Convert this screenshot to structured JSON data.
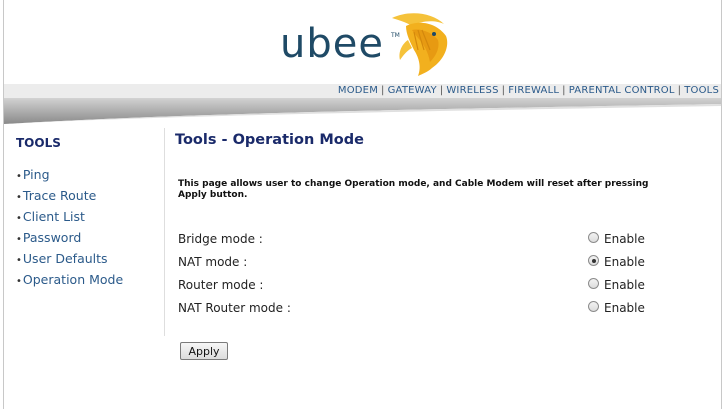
{
  "brand": {
    "logo_text": "ubee",
    "trademark": "TM"
  },
  "topnav": {
    "items": [
      "MODEM",
      "GATEWAY",
      "WIRELESS",
      "FIREWALL",
      "PARENTAL CONTROL",
      "TOOLS"
    ],
    "separator": "|"
  },
  "sidebar": {
    "title": "TOOLS",
    "items": [
      {
        "label": "Ping"
      },
      {
        "label": "Trace Route"
      },
      {
        "label": "Client List"
      },
      {
        "label": "Password"
      },
      {
        "label": "User Defaults"
      },
      {
        "label": "Operation Mode"
      }
    ],
    "bullet": "•"
  },
  "main": {
    "title": "Tools - Operation Mode",
    "description": "This page allows user to change Operation mode, and Cable Modem will reset after pressing Apply button.",
    "modes": [
      {
        "label": "Bridge mode :",
        "option": "Enable",
        "checked": false
      },
      {
        "label": "NAT mode :",
        "option": "Enable",
        "checked": true
      },
      {
        "label": "Router mode :",
        "option": "Enable",
        "checked": false
      },
      {
        "label": "NAT Router mode :",
        "option": "Enable",
        "checked": false
      }
    ],
    "apply_label": "Apply"
  },
  "colors": {
    "link": "#2b5a8a",
    "heading": "#1a2a6a",
    "logo_text": "#1f4a66",
    "logo_fish": "#f2b01e"
  }
}
